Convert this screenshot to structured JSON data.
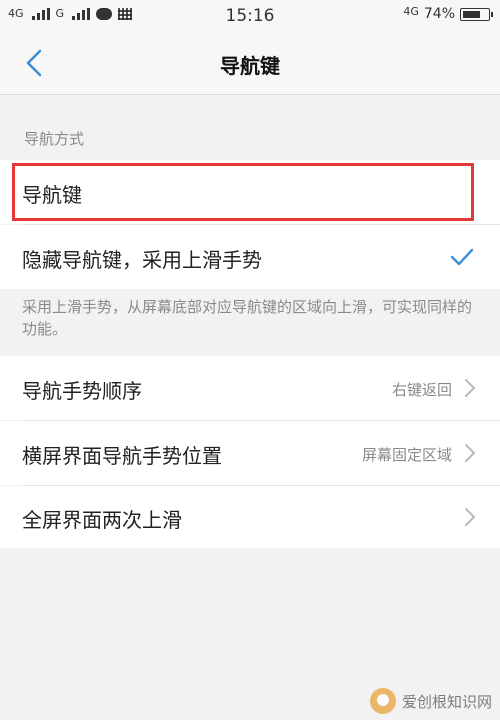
{
  "status_bar": {
    "left_net_1": "4G",
    "left_net_2": "G",
    "time": "15:16",
    "right_net": "4G",
    "battery": "74%",
    "battery_level": 0.74
  },
  "header": {
    "title": "导航键"
  },
  "section": {
    "label": "导航方式"
  },
  "options": [
    {
      "label": "导航键",
      "selected": false
    },
    {
      "label": "隐藏导航键，采用上滑手势",
      "selected": true
    }
  ],
  "description": "采用上滑手势，从屏幕底部对应导航键的区域向上滑，可实现同样的功能。",
  "settings": [
    {
      "label": "导航手势顺序",
      "value": "右键返回"
    },
    {
      "label": "横屏界面导航手势位置",
      "value": "屏幕固定区域"
    },
    {
      "label": "全屏界面两次上滑",
      "value": ""
    }
  ],
  "watermark": "爱创根知识网",
  "colors": {
    "accent": "#3d8fd8",
    "highlight": "#e53935"
  }
}
